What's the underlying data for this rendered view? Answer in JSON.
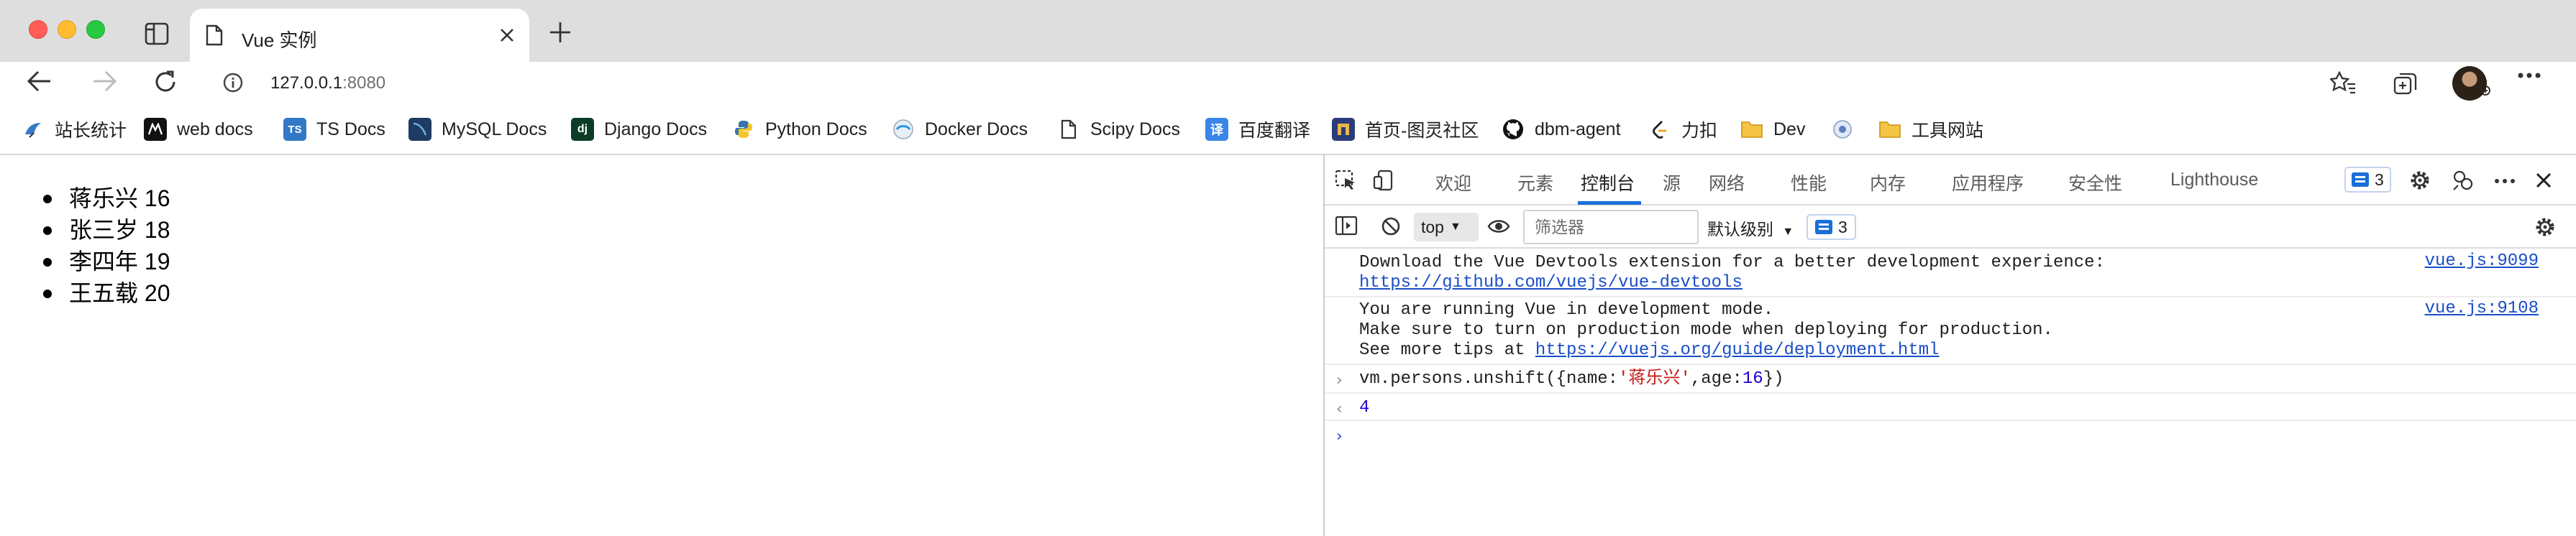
{
  "browser": {
    "tab": {
      "title": "Vue 实例"
    },
    "address": {
      "host": "127.0.0.1",
      "port": ":8080"
    }
  },
  "bookmarks": [
    {
      "label": "站长统计",
      "icon": "bird-icon"
    },
    {
      "label": "web docs",
      "icon": "mdn-icon"
    },
    {
      "label": "TS Docs",
      "icon": "ts-icon"
    },
    {
      "label": "MySQL Docs",
      "icon": "mysql-icon"
    },
    {
      "label": "Django Docs",
      "icon": "django-icon"
    },
    {
      "label": "Python Docs",
      "icon": "python-icon"
    },
    {
      "label": "Docker Docs",
      "icon": "docker-icon"
    },
    {
      "label": "Scipy Docs",
      "icon": "page-icon"
    },
    {
      "label": "百度翻译",
      "icon": "translate-icon"
    },
    {
      "label": "首页-图灵社区",
      "icon": "turing-icon"
    },
    {
      "label": "dbm-agent",
      "icon": "github-icon"
    },
    {
      "label": "力扣",
      "icon": "leetcode-icon"
    },
    {
      "label": "Dev",
      "icon": "folder-icon"
    },
    {
      "label": "",
      "icon": "globe-icon"
    },
    {
      "label": "工具网站",
      "icon": "folder-icon"
    }
  ],
  "page": {
    "persons": [
      "蒋乐兴 16",
      "张三岁 18",
      "李四年 19",
      "王五载 20"
    ]
  },
  "devtools": {
    "tabs": [
      "欢迎",
      "元素",
      "控制台",
      "源",
      "网络",
      "性能",
      "内存",
      "应用程序",
      "安全性",
      "Lighthouse"
    ],
    "active_tab": "控制台",
    "issues_count": "3",
    "console_bar": {
      "context": "top",
      "filter_placeholder": "筛选器",
      "level": "默认级别",
      "issues_count": "3"
    },
    "console": {
      "log1_line1": "Download the Vue Devtools extension for a better development experience:",
      "log1_link": "https://github.com/vuejs/vue-devtools",
      "log1_source": "vue.js:9099",
      "log2_line1": "You are running Vue in development mode.",
      "log2_line2": "Make sure to turn on production mode when deploying for production.",
      "log2_line3_prefix": "See more tips at ",
      "log2_link": "https://vuejs.org/guide/deployment.html",
      "log2_source": "vue.js:9108",
      "input_prefix": "vm.persons.unshift({name:",
      "input_string": "'蒋乐兴'",
      "input_mid": ",age:",
      "input_number": "16",
      "input_suffix": "})",
      "result": "4"
    }
  },
  "colors": {
    "accent": "#1a6fd9",
    "link": "#1a4ec9"
  }
}
